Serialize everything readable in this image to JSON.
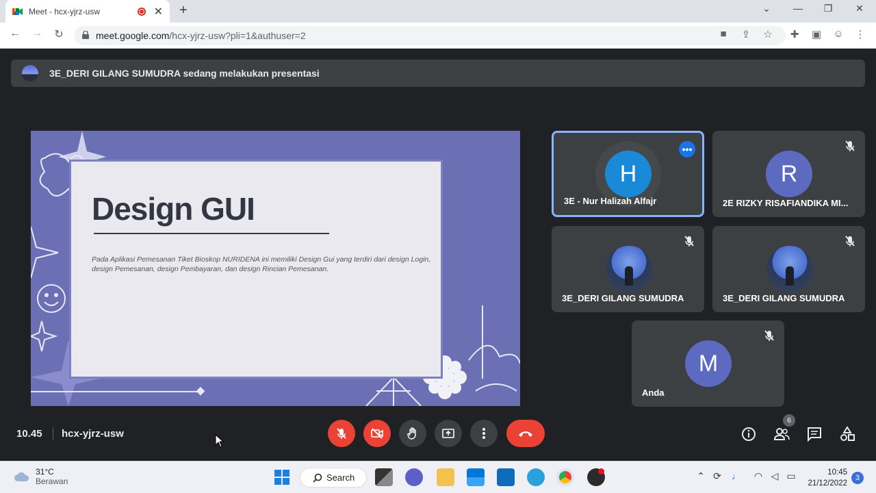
{
  "browser": {
    "tab_title": "Meet - hcx-yjrz-usw",
    "url_host": "meet.google.com",
    "url_path": "/hcx-yjrz-usw?pli=1&authuser=2",
    "new_tab": "+",
    "tab_close": "✕",
    "nav": {
      "back": "←",
      "forward": "→",
      "reload": "↻"
    },
    "window": {
      "minimize": "⌄",
      "min": "—",
      "restore": "❐",
      "close": "✕"
    }
  },
  "meet": {
    "presenter_banner": "3E_DERI GILANG SUMUDRA sedang melakukan presentasi",
    "slide": {
      "title": "Design GUI",
      "body": "Pada Aplikasi Pemesanan Tiket Bioskop NURIDENA ini memiliki Design Gui yang terdiri dari design Login, design Pemesanan, design Pembayaran, dan design Rincian Pemesanan."
    },
    "participants": [
      {
        "name": "3E - Nur Halizah Alfajr",
        "initial": "H",
        "color": "#1a8ad8",
        "active": true
      },
      {
        "name": "2E RIZKY RISAFIANDIKA MI...",
        "initial": "R",
        "color": "#5c6bc0",
        "muted": true
      },
      {
        "name": "3E_DERI GILANG SUMUDRA",
        "initial": "",
        "muted": true,
        "photo": true
      },
      {
        "name": "3E_DERI GILANG SUMUDRA",
        "initial": "",
        "muted": true,
        "photo": true
      },
      {
        "name": "Anda",
        "initial": "M",
        "color": "#5c6bc0",
        "muted": true
      }
    ],
    "time": "10.45",
    "meeting_code": "hcx-yjrz-usw",
    "people_count": "6"
  },
  "taskbar": {
    "weather_temp": "31°C",
    "weather_desc": "Berawan",
    "search_label": "Search",
    "clock_time": "10:45",
    "clock_date": "21/12/2022",
    "notifications": "3"
  },
  "colors": {
    "end_call": "#ea4335",
    "active_border": "#8ab4f8",
    "tile_bg": "#3c4043"
  }
}
